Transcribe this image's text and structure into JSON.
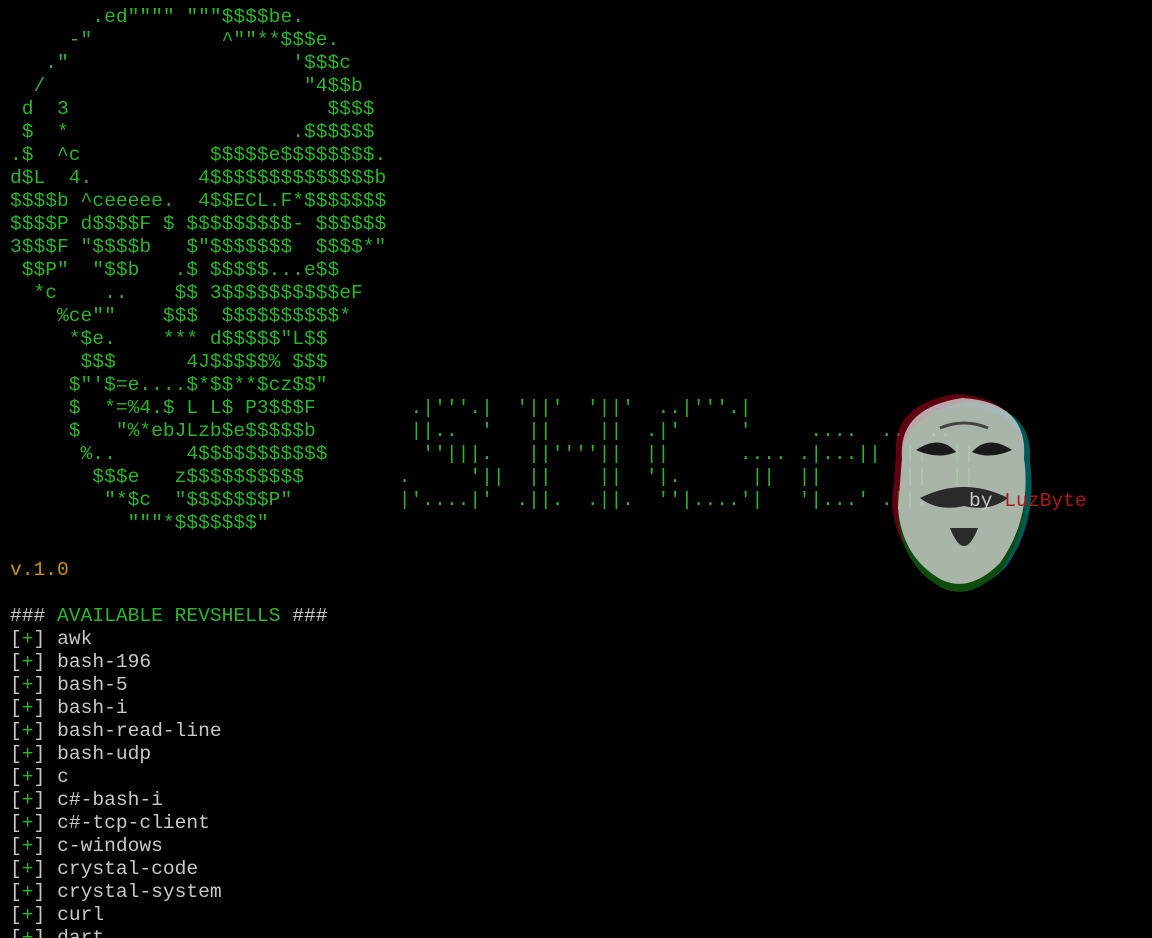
{
  "colors": {
    "background": "#000000",
    "ascii_green": "#2bb52b",
    "version_orange": "#c8930a",
    "text_gray": "#c8c8c8",
    "author_red": "#b01818"
  },
  "logo_art": [
    "       .ed\"\"\"\" \"\"\"$$$$be.",
    "     -\"           ^\"\"**$$$e.",
    "   .\"                   '$$$c",
    "  /                      \"4$$b",
    " d  3                      $$$$",
    " $  *                   .$$$$$$",
    ".$  ^c           $$$$$e$$$$$$$$.",
    "d$L  4.         4$$$$$$$$$$$$$$b",
    "$$$$b ^ceeeee.  4$$ECL.F*$$$$$$$",
    "$$$$P d$$$$F $ $$$$$$$$$- $$$$$$",
    "3$$$F \"$$$$b   $\"$$$$$$$  $$$$*\"",
    " $$P\"  \"$$b   .$ $$$$$...e$$",
    "  *c    ..    $$ 3$$$$$$$$$$eF",
    "    %ce\"\"    $$$  $$$$$$$$$$*",
    "     *$e.    *** d$$$$$\"L$$",
    "      $$$      4J$$$$$% $$$",
    "     $\"'$=e....$*$$**$cz$$\"",
    "     $  *=%4.$ L L$ P3$$$F",
    "     $   \"%*ebJLzb$e$$$$$b",
    "      %..      4$$$$$$$$$$$",
    "       $$$e   z$$$$$$$$$$",
    "        \"*$c  \"$$$$$$$P\"",
    "          \"\"\"*$$$$$$$\""
  ],
  "banner_art": [
    "      .|'''.|  '||'  '||'  ..|'''.|",
    "      ||..  '   ||    ||  .|'     '     ....  ..  ..",
    "       ''|||.   ||''''||  ||      .... .|...||  ||  ||",
    "     .     '||  ||    ||  '|.      ||  ||       ||  ||",
    "     |'....|'  .||.  .||.  ''|....'|   '|...' .||. ||."
  ],
  "credit": {
    "by": "by",
    "author": "LuzByte"
  },
  "version": "v.1.0",
  "heading": {
    "hash_open": "###",
    "title": "AVAILABLE REVSHELLS",
    "hash_close": "###"
  },
  "marker": {
    "open": "[",
    "symbol": "+",
    "close": "]"
  },
  "revshells": [
    "awk",
    "bash-196",
    "bash-5",
    "bash-i",
    "bash-read-line",
    "bash-udp",
    "c",
    "c#-bash-i",
    "c#-tcp-client",
    "c-windows",
    "crystal-code",
    "crystal-system",
    "curl",
    "dart"
  ],
  "icon": "guy-fawkes-mask-icon"
}
